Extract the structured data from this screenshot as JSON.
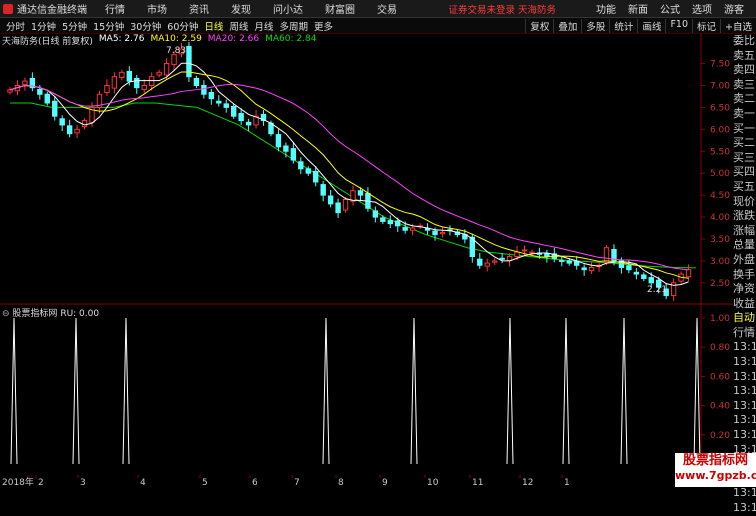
{
  "app": {
    "title": "通达信金融终端",
    "status": "证券交易未登录",
    "stock_name": "天海防务"
  },
  "menu": [
    "行情",
    "市场",
    "资讯",
    "发现",
    "问小达",
    "财富圈",
    "交易"
  ],
  "right_menu": [
    "功能",
    "新面",
    "公式",
    "选项",
    "游客"
  ],
  "period_tabs": [
    "分时",
    "1分钟",
    "5分钟",
    "15分钟",
    "30分钟",
    "60分钟",
    "日线",
    "周线",
    "月线",
    "多周期",
    "更多"
  ],
  "active_tab": "日线",
  "right_tabs": [
    "复权",
    "叠加",
    "多股",
    "统计",
    "画线",
    "F10",
    "标记",
    "+自选"
  ],
  "main_legend": {
    "title": "天海防务(日线 前复权)",
    "ma5": "MA5: 2.76",
    "ma10": "MA10: 2.59",
    "ma20": "MA20: 2.66",
    "ma60": "MA60: 2.84"
  },
  "high_label": "7.83",
  "low_label": "2.21",
  "y_ticks_main": [
    "7.50",
    "7.00",
    "6.50",
    "6.00",
    "5.50",
    "5.00",
    "4.50",
    "4.00",
    "3.50",
    "3.00",
    "2.50"
  ],
  "sub_indicator": {
    "name": "股票指标网",
    "value": "RU: 0.00"
  },
  "y_ticks_sub": [
    "1.00",
    "0.80",
    "0.60",
    "0.40",
    "0.20",
    "0.00"
  ],
  "date_axis": [
    "2018年",
    "2",
    "3",
    "4",
    "5",
    "6",
    "7",
    "8",
    "9",
    "10",
    "11",
    "12",
    "1"
  ],
  "right_panel": [
    "委比",
    "卖五",
    "卖四",
    "卖三",
    "卖二",
    "卖一",
    "买一",
    "买二",
    "买三",
    "买四",
    "买五",
    "现价",
    "涨跌",
    "涨幅",
    "总量",
    "外盘",
    "换手",
    "净资",
    "收益",
    "自动",
    "行情",
    "13:1",
    "13:1",
    "13:1",
    "13:1",
    "13:1",
    "13:1",
    "13:1",
    "13:1",
    "13:1",
    "13:1",
    "13:1",
    "13:1"
  ],
  "watermark": {
    "line1": "股票指标网",
    "line2": "www.7gpzb.com"
  },
  "colors": {
    "up": "#ff3232",
    "down": "#54ffff",
    "ma5": "#ffffff",
    "ma10": "#ffff00",
    "ma20": "#ff40ff",
    "ma60": "#00d800",
    "axis": "#8b0000"
  },
  "chart_data": {
    "type": "candlestick",
    "y_range": [
      2.2,
      7.9
    ],
    "series_close": [
      6.9,
      7.0,
      7.1,
      6.95,
      6.8,
      6.6,
      6.3,
      6.1,
      5.9,
      6.0,
      6.2,
      6.5,
      6.8,
      7.0,
      7.2,
      7.3,
      7.1,
      6.95,
      7.0,
      7.2,
      7.3,
      7.5,
      7.7,
      7.83,
      7.2,
      7.0,
      6.8,
      6.7,
      6.6,
      6.5,
      6.3,
      6.2,
      6.1,
      6.3,
      6.2,
      5.9,
      5.6,
      5.5,
      5.3,
      5.1,
      5.0,
      4.8,
      4.5,
      4.3,
      4.1,
      4.4,
      4.6,
      4.5,
      4.2,
      4.0,
      3.9,
      3.85,
      3.8,
      3.7,
      3.75,
      3.8,
      3.7,
      3.6,
      3.65,
      3.7,
      3.6,
      3.5,
      3.1,
      2.9,
      2.95,
      3.0,
      3.05,
      3.1,
      3.2,
      3.25,
      3.2,
      3.15,
      3.1,
      3.05,
      3.0,
      2.95,
      2.9,
      2.8,
      2.85,
      2.9,
      3.3,
      3.0,
      2.85,
      2.8,
      2.7,
      2.6,
      2.5,
      2.4,
      2.21,
      2.5,
      2.7,
      2.8
    ],
    "ma60_approx": [
      6.6,
      6.6,
      6.5,
      6.5,
      6.5,
      6.5,
      6.6,
      6.6,
      6.55,
      6.5,
      6.3,
      6.1,
      5.8,
      5.5,
      5.2,
      4.9,
      4.6,
      4.3,
      4.0,
      3.8,
      3.6,
      3.45,
      3.3,
      3.2,
      3.15,
      3.1,
      3.05,
      3.0,
      2.98,
      2.95,
      2.9,
      2.87,
      2.85,
      2.84
    ]
  }
}
